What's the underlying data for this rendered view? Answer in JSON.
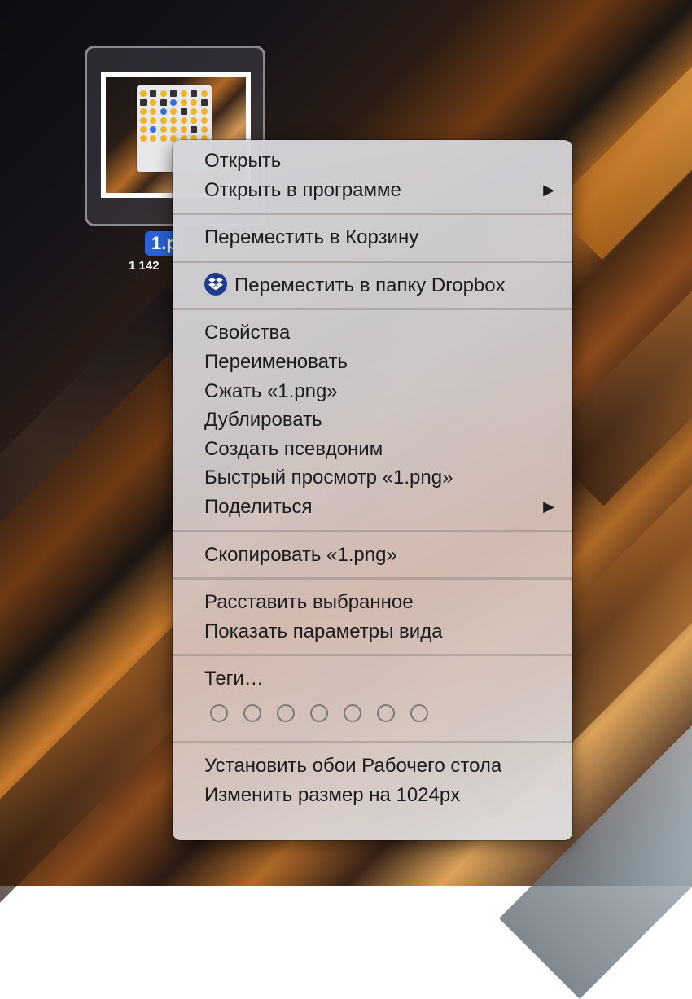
{
  "desktop_file": {
    "name_label": "1.p",
    "size_label": "1 142"
  },
  "menu": {
    "groups": [
      {
        "items": [
          {
            "label": "Открыть"
          },
          {
            "label": "Открыть в программе",
            "submenu": true
          }
        ]
      },
      {
        "items": [
          {
            "label": "Переместить в Корзину"
          }
        ]
      },
      {
        "items": [
          {
            "label": "Переместить в папку Dropbox",
            "icon": "dropbox-icon"
          }
        ]
      },
      {
        "items": [
          {
            "label": "Свойства"
          },
          {
            "label": "Переименовать"
          },
          {
            "label": "Сжать «1.png»"
          },
          {
            "label": "Дублировать"
          },
          {
            "label": "Создать псевдоним"
          },
          {
            "label": "Быстрый просмотр «1.png»"
          },
          {
            "label": "Поделиться",
            "submenu": true
          }
        ]
      },
      {
        "items": [
          {
            "label": "Скопировать «1.png»"
          }
        ]
      },
      {
        "items": [
          {
            "label": "Расставить выбранное"
          },
          {
            "label": "Показать параметры вида"
          }
        ]
      },
      {
        "items": [
          {
            "label": "Теги…"
          }
        ],
        "tag_colors": [
          "none",
          "none",
          "none",
          "none",
          "none",
          "none",
          "none"
        ]
      },
      {
        "items": [
          {
            "label": "Установить обои Рабочего стола"
          },
          {
            "label": "Изменить размер на 1024px"
          }
        ]
      }
    ],
    "submenu_arrow": "▶"
  },
  "colors": {
    "selection_blue": "#2b63d6",
    "dropbox_blue": "#1f3a8a"
  }
}
